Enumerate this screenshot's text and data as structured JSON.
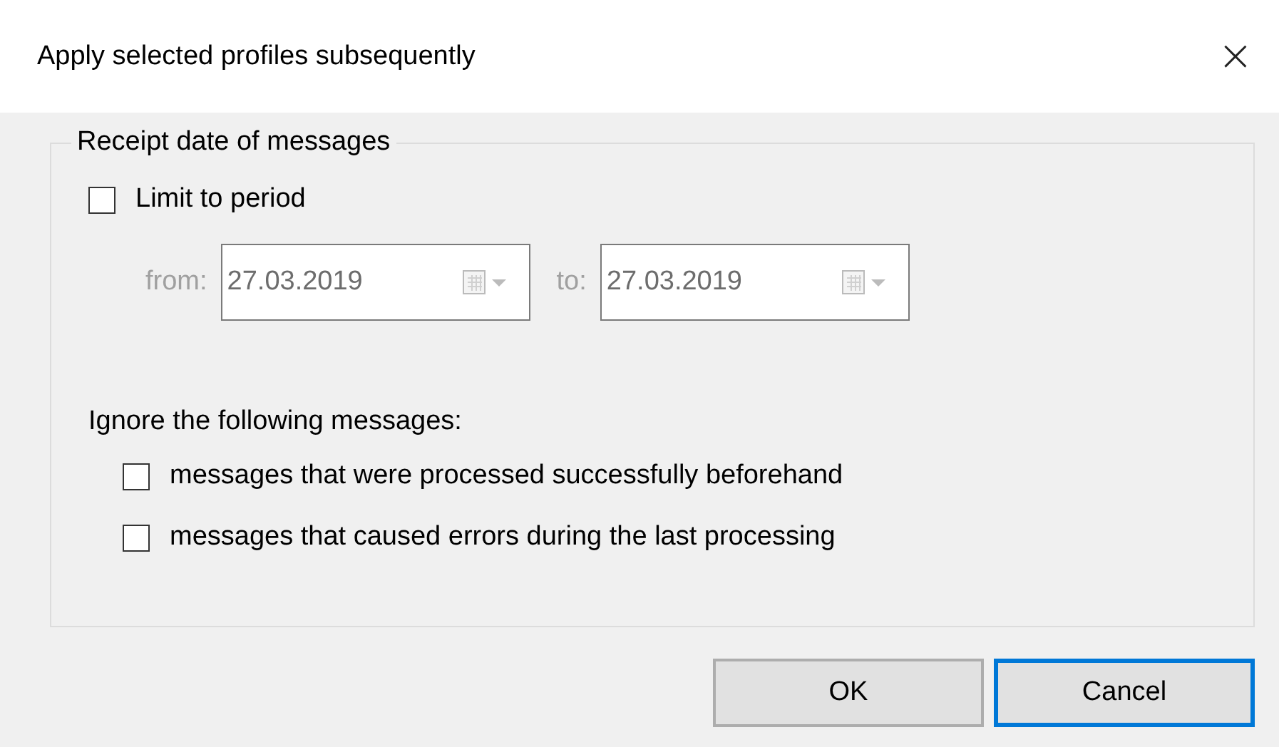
{
  "window": {
    "title": "Apply selected profiles subsequently",
    "close": "×"
  },
  "group": {
    "legend": "Receipt date of messages",
    "limit": {
      "label": "Limit to period",
      "checked": false
    },
    "dates": [
      {
        "label": "from:",
        "value": "27.03.2019",
        "disabled": true
      },
      {
        "label": "to:",
        "value": "27.03.2019",
        "disabled": true
      }
    ],
    "ignore_label": "Ignore the following messages:",
    "ignore_options": [
      {
        "label": "messages that were processed successfully beforehand",
        "checked": false
      },
      {
        "label": "messages that caused errors during the last processing",
        "checked": false
      }
    ]
  },
  "buttons": [
    {
      "label": "OK",
      "focused": false
    },
    {
      "label": "Cancel",
      "focused": true
    }
  ]
}
